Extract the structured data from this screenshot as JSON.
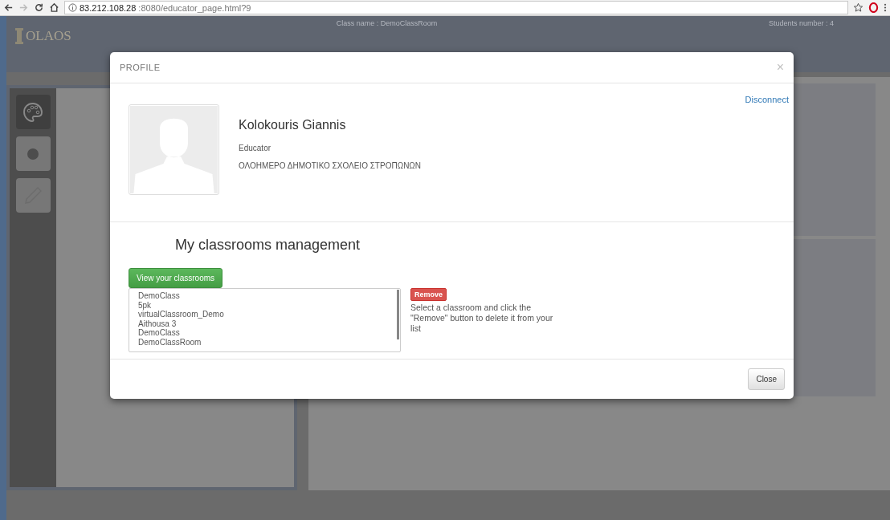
{
  "browser": {
    "url_host": "83.212.108.28",
    "url_rest": ":8080/educator_page.html?9"
  },
  "header": {
    "logo": "OLAOS",
    "class_name": "Class name : DemoClassRoom",
    "students": "Students number : 4"
  },
  "tools": [
    {
      "kind": "palette",
      "selected": true
    },
    {
      "kind": "circle",
      "selected": false
    },
    {
      "kind": "pencil",
      "selected": false
    }
  ],
  "modal": {
    "title": "PROFILE",
    "close_symbol": "×",
    "disconnect": "Disconnect",
    "name": "Kolokouris Giannis",
    "role": "Educator",
    "school": "ΟΛΟΗΜΕΡΟ ΔΗΜΟΤΙΚΟ ΣΧΟΛΕΙΟ ΣΤΡΟΠΩΝΩΝ",
    "section_title": "My classrooms management",
    "view_button": "View your classrooms",
    "classrooms": [
      "DemoClass",
      "5pk",
      "virtualClassroom_Demo",
      "Aithousa 3",
      "DemoClass",
      "DemoClassRoom"
    ],
    "remove_button": "Remove",
    "remove_hint": "Select a classroom and click the \"Remove\" button to delete it from your list",
    "footer_button": "Close"
  }
}
